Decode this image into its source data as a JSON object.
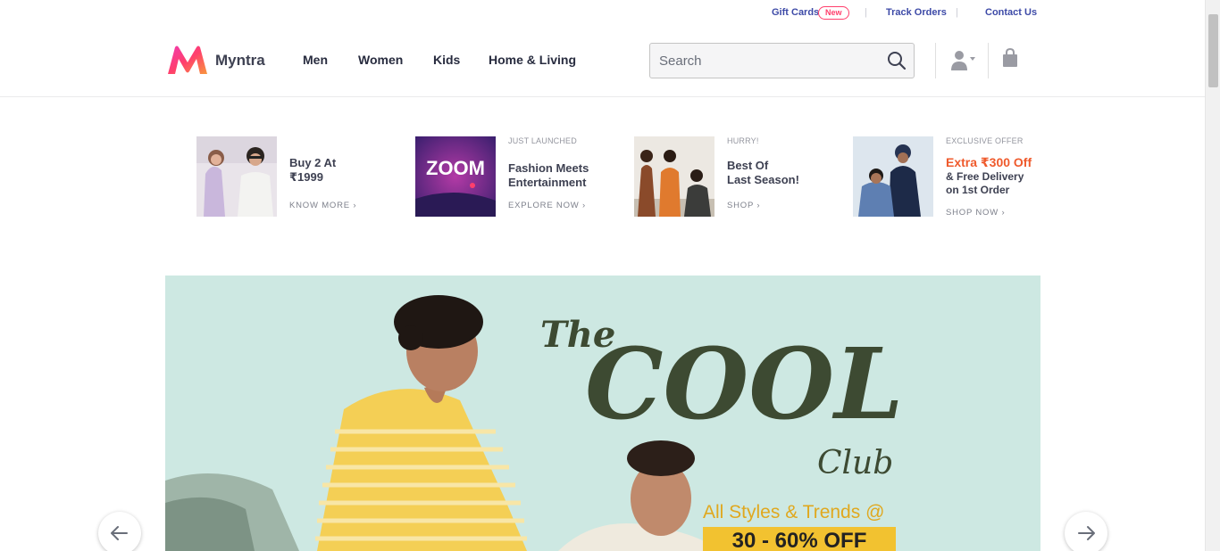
{
  "top_links": {
    "gift_cards": "Gift Cards",
    "new_badge": "New",
    "track_orders": "Track Orders",
    "contact_us": "Contact Us",
    "separator": "|"
  },
  "header": {
    "brand": "Myntra",
    "nav": [
      "Men",
      "Women",
      "Kids",
      "Home & Living"
    ],
    "search": {
      "placeholder": "Search",
      "value": ""
    },
    "icons": [
      "search-icon",
      "user-icon",
      "bag-icon"
    ]
  },
  "promos": [
    {
      "kicker": "",
      "title": "Buy 2 At\n₹1999",
      "link": "KNOW MORE ›"
    },
    {
      "kicker": "JUST LAUNCHED",
      "title": "Fashion Meets\nEntertainment",
      "link": "EXPLORE NOW ›",
      "tile_text": "ZOOM"
    },
    {
      "kicker": "HURRY!",
      "title": "Best Of\nLast Season!",
      "link": "SHOP ›"
    },
    {
      "kicker": "EXCLUSIVE OFFER",
      "title_accent": "Extra ₹300 Off",
      "title": "& Free Delivery\non 1st Order",
      "link": "SHOP NOW ›"
    }
  ],
  "banner": {
    "headline_small": "The",
    "headline_big": "COOL",
    "headline_tail": "Club",
    "tagline": "All Styles & Trends @",
    "offer": "30 - 60% OFF"
  },
  "colors": {
    "brand_pink": "#ff3f6c",
    "link_blue": "#3d4aa7",
    "accent_orange": "#ef5a2c",
    "banner_bg": "#c9e6e0",
    "headline_green": "#3d4a32",
    "offer_yellow": "#f2c230"
  }
}
